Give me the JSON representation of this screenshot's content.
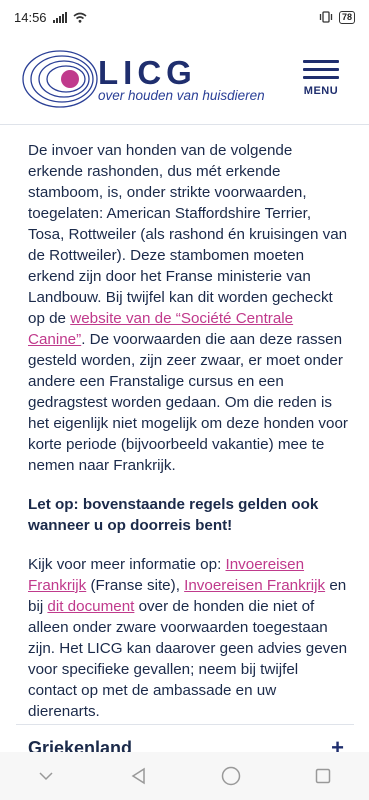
{
  "status": {
    "time": "14:56",
    "battery": "78"
  },
  "header": {
    "brand": "LICG",
    "tagline": "over houden van huisdieren",
    "menu_label": "MENU"
  },
  "colors": {
    "navy": "#1f2e6e",
    "link": "#c03a8c",
    "logo_ring": "#2a3f96",
    "logo_dot": "#c03a8c"
  },
  "content": {
    "p1_text1": "De invoer van honden van de volgende erkende rashonden, dus mét erkende stamboom, is, onder strikte voorwaarden, toegelaten: American Staffordshire Terrier, Tosa, Rottweiler (als rashond én kruisingen van de Rottweiler). Deze stambomen moeten erkend zijn door het Franse ministerie van Landbouw. Bij twijfel kan dit worden gecheckt op de ",
    "p1_link": "website van de “Société Centrale Canine”",
    "p1_text2": ". De voorwaarden die aan deze rassen gesteld worden, zijn zeer zwaar, er moet onder andere een Franstalige cursus en een gedragstest worden gedaan. Om die reden is het eigenlijk niet mogelijk om deze honden voor korte periode (bijvoorbeeld vakantie) mee te nemen naar Frankrijk.",
    "p2_bold": "Let op: bovenstaande regels gelden ook wanneer u op doorreis bent!",
    "p3_text1": "Kijk voor meer informatie op: ",
    "p3_link1": "Invoereisen Frankrijk",
    "p3_text2": " (Franse site), ",
    "p3_link2": "Invoereisen Frankrijk",
    "p3_text3": " en bij ",
    "p3_link3": "dit document",
    "p3_text4": " over de honden die niet of alleen onder zware voorwaarden toegestaan zijn. Het LICG kan daarover geen advies geven voor specifieke gevallen; neem bij twijfel contact op met de ambassade en uw dierenarts."
  },
  "accordion": {
    "title": "Griekenland",
    "icon": "+"
  },
  "icons": {
    "nav": [
      "chevron-down-icon",
      "back-triangle-icon",
      "home-circle-icon",
      "recents-square-icon"
    ]
  }
}
